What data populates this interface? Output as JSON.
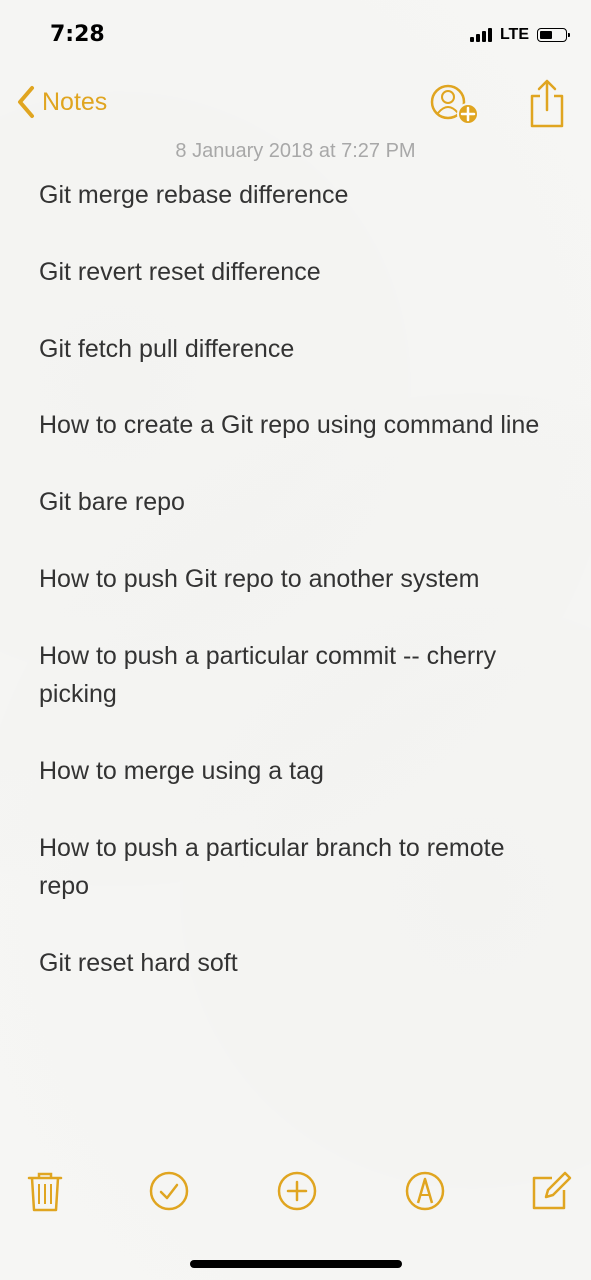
{
  "status_bar": {
    "time": "7:28",
    "carrier": "LTE"
  },
  "nav": {
    "back_label": "Notes",
    "icons": {
      "back": "chevron-left-icon",
      "add_people": "add-person-icon",
      "share": "share-icon"
    }
  },
  "note": {
    "date": "8 January 2018 at 7:27 PM",
    "lines": [
      "Git merge rebase difference",
      "Git revert reset difference",
      "Git fetch pull difference",
      "How to create a Git repo using command line",
      "Git bare repo",
      "How to push Git repo to another system",
      "How to push a particular commit -- cherry picking",
      "How to merge using a tag",
      "How to push a particular branch to remote repo",
      "Git reset hard soft"
    ]
  },
  "toolbar": {
    "icons": [
      "trash-icon",
      "checklist-icon",
      "add-icon",
      "markup-icon",
      "compose-icon"
    ]
  },
  "colors": {
    "accent": "#e0a520",
    "text": "#333333",
    "date": "#a8a8a8",
    "background": "#f6f6f4"
  }
}
